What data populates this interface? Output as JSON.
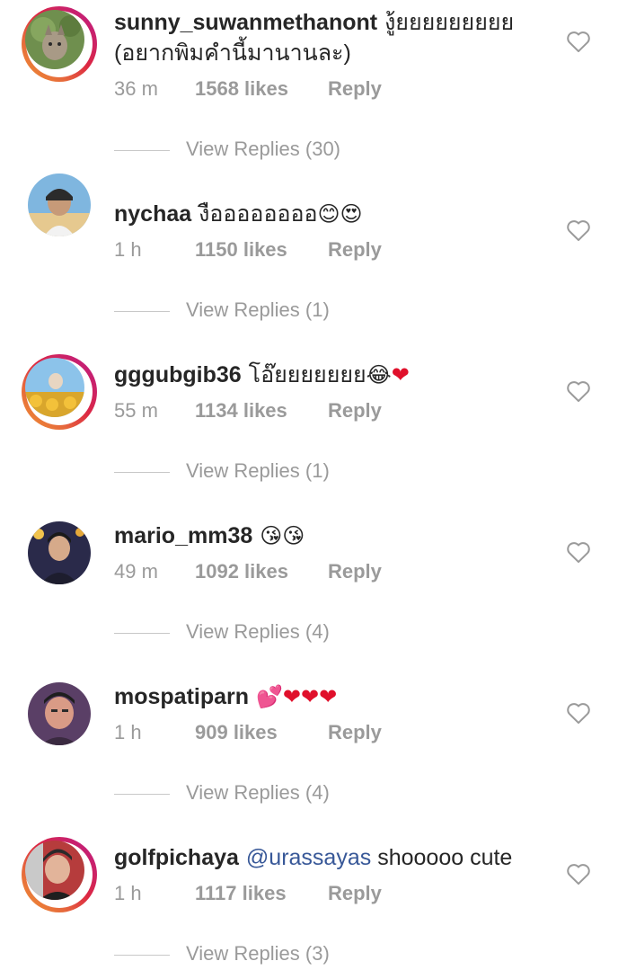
{
  "comments": [
    {
      "username": "sunny_suwanmethanont",
      "text": "งู้ยยยยยยยยย (อยากพิมคำนี้มานานละ)",
      "time": "36 m",
      "likes": "1568 likes",
      "reply_label": "Reply",
      "view_replies": "View Replies (30)",
      "has_story_ring": true
    },
    {
      "username": "nychaa",
      "text": "งืออออออออ",
      "emojis": "😊😍",
      "time": "1 h",
      "likes": "1150 likes",
      "reply_label": "Reply",
      "view_replies": "View Replies (1)",
      "has_story_ring": false
    },
    {
      "username": "gggubgib36",
      "text": "โอ๊ยยยยยยย",
      "emojis": "😂",
      "hearts": "❤",
      "time": "55 m",
      "likes": "1134 likes",
      "reply_label": "Reply",
      "view_replies": "View Replies (1)",
      "has_story_ring": true
    },
    {
      "username": "mario_mm38",
      "emojis": "😘😘",
      "time": "49 m",
      "likes": "1092 likes",
      "reply_label": "Reply",
      "view_replies": "View Replies (4)",
      "has_story_ring": false
    },
    {
      "username": "mospatiparn",
      "emojis": "💕",
      "hearts": "❤❤❤",
      "time": "1 h",
      "likes": "909 likes",
      "reply_label": "Reply",
      "view_replies": "View Replies (4)",
      "has_story_ring": false
    },
    {
      "username": "golfpichaya",
      "mention": "@urassayas",
      "text": "shooooo cute",
      "time": "1 h",
      "likes": "1117 likes",
      "reply_label": "Reply",
      "view_replies": "View Replies (3)",
      "has_story_ring": true
    }
  ],
  "colors": {
    "text": "#262626",
    "meta": "#9a9a9a",
    "mention": "#385898",
    "heart": "#e0102b",
    "ring_start": "#f09433",
    "ring_end": "#bc1888"
  },
  "icons": {
    "like": "heart-outline-icon"
  }
}
